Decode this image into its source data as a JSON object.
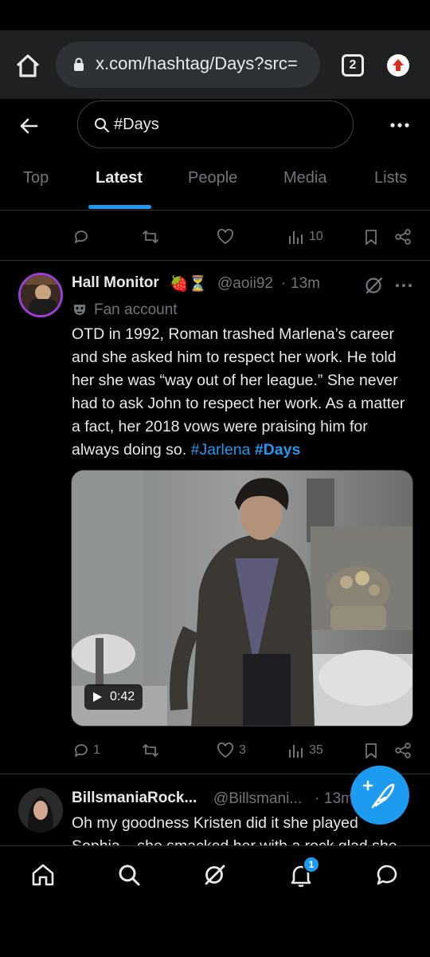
{
  "browser": {
    "url": "x.com/hashtag/Days?src=",
    "tab_count": "2"
  },
  "search": {
    "query": "#Days"
  },
  "tabs": [
    {
      "label": "Top"
    },
    {
      "label": "Latest"
    },
    {
      "label": "People"
    },
    {
      "label": "Media"
    },
    {
      "label": "Lists"
    }
  ],
  "prev_tweet": {
    "views": "10"
  },
  "tweet": {
    "name": "Hall Monitor",
    "emojis": "🍓⏳",
    "handle": "@aoii92",
    "sep": "·",
    "time": "13m",
    "label": "Fan account",
    "text": "OTD in 1992, Roman trashed Marlena’s career and she asked him to respect her work. He told her she was “way out of her league.” She never had to ask John to respect her work. As a matter a fact, her 2018 vows were praising him for always doing so.",
    "hashtag1": "#Jarlena",
    "hashtag2": "#Days",
    "video_duration": "0:42",
    "replies": "1",
    "likes": "3",
    "views": "35"
  },
  "next_tweet": {
    "name": "BillsmaniaRock...",
    "handle": "@Billsmani...",
    "sep": "·",
    "time": "13m",
    "text": "Oh my goodness Kristen did it she played Sophia... she smacked her with a rock glad she"
  },
  "bottom_nav": {
    "notification_count": "1"
  },
  "colors": {
    "accent": "#1d9bf0",
    "muted": "#71767b",
    "background": "#000000"
  }
}
